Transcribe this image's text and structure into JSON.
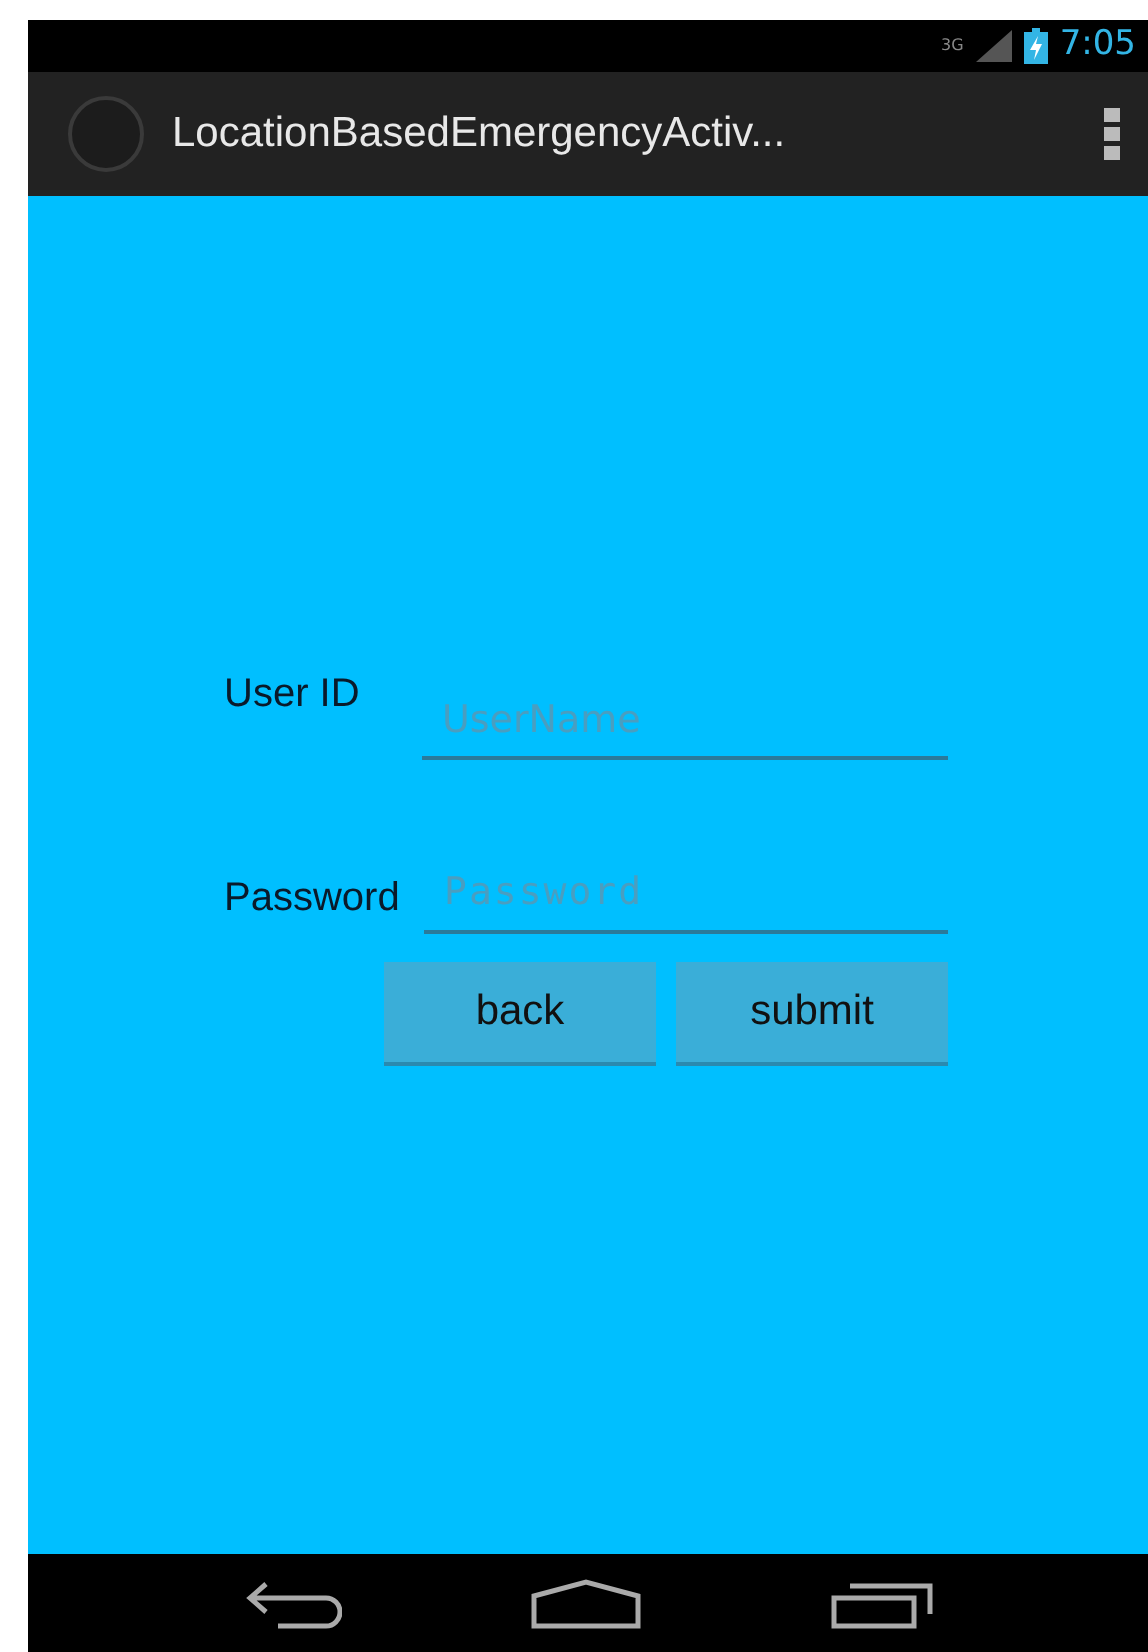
{
  "status_bar": {
    "network": "3G",
    "time": "7:05"
  },
  "action_bar": {
    "title": "LocationBasedEmergencyActiv..."
  },
  "form": {
    "fields": [
      {
        "label": "User ID",
        "placeholder": "UserName",
        "kind": "text"
      },
      {
        "label": "Password",
        "placeholder": "Password",
        "kind": "password"
      }
    ],
    "buttons": [
      "back",
      "submit"
    ]
  }
}
